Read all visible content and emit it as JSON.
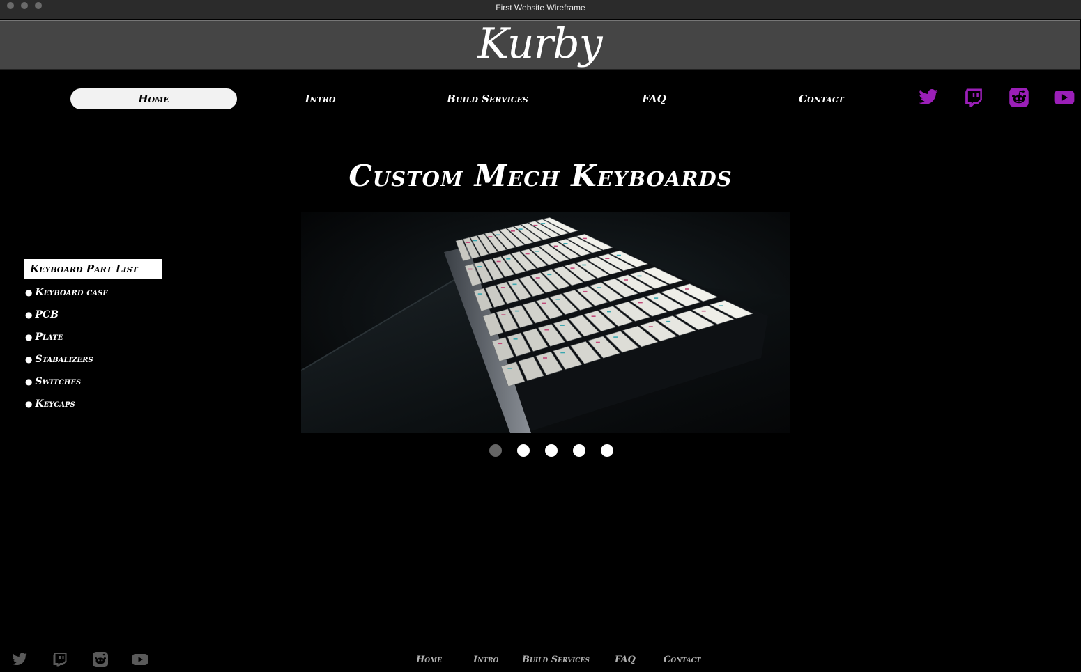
{
  "window": {
    "title": "First Website Wireframe"
  },
  "brand": {
    "logo": "Kurby"
  },
  "nav": {
    "items": [
      {
        "label": "Home",
        "active": true
      },
      {
        "label": "Intro"
      },
      {
        "label": "Build Services"
      },
      {
        "label": "FAQ"
      },
      {
        "label": "Contact"
      }
    ]
  },
  "social": {
    "accent": "#9b1fb8",
    "footer_color": "#5a5a5a",
    "icons": [
      "twitter-icon",
      "twitch-icon",
      "reddit-icon",
      "youtube-icon"
    ]
  },
  "hero": {
    "title": "Custom Mech Keyboards"
  },
  "parts": {
    "header": "Keyboard Part List",
    "items": [
      "Keyboard case",
      "PCB",
      "Plate",
      "Stabalizers",
      "Switches",
      "Keycaps"
    ]
  },
  "carousel": {
    "slide_count": 5,
    "active_index": 0
  },
  "footer": {
    "links": [
      "Home",
      "Intro",
      "Build Services",
      "FAQ",
      "Contact"
    ]
  }
}
